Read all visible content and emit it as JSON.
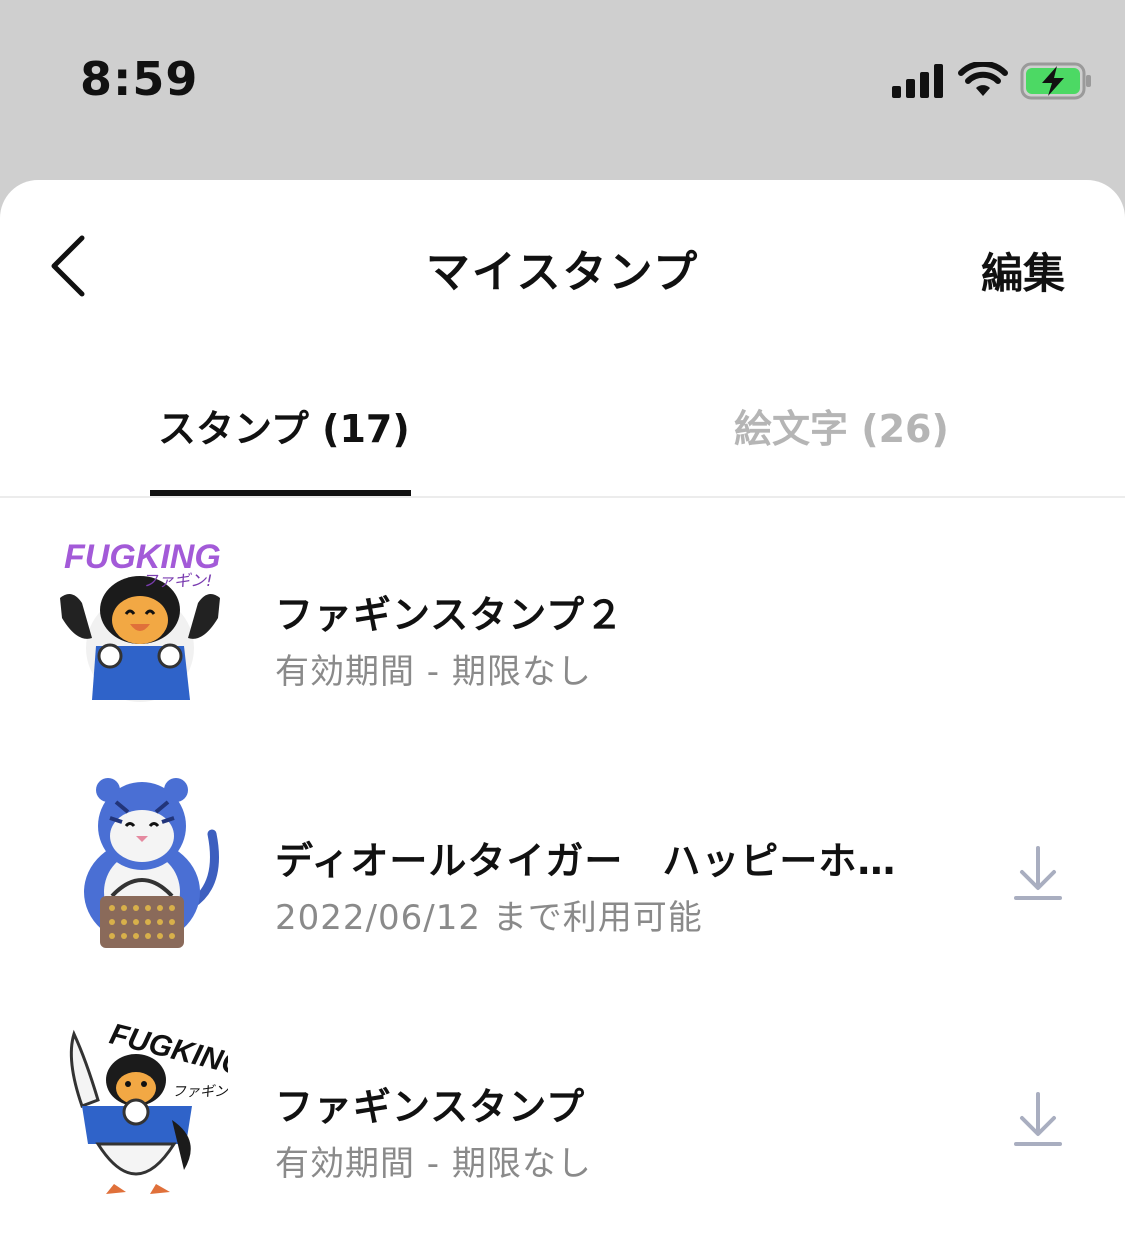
{
  "status_bar": {
    "time": "8:59",
    "icons": [
      "cellular-signal-icon",
      "wifi-icon",
      "battery-charging-icon"
    ],
    "battery_color": "#4cd964"
  },
  "header": {
    "back_icon": "chevron-left-icon",
    "title": "マイスタンプ",
    "edit_label": "編集"
  },
  "tabs": [
    {
      "label": "スタンプ (17)",
      "selected": true
    },
    {
      "label": "絵文字 (26)",
      "selected": false
    }
  ],
  "stickers": [
    {
      "title": "ファギンスタンプ２",
      "subtitle": "有効期間 - 期限なし",
      "thumbnail_text": "FUGKING",
      "thumbnail_subtext": "ファギン!",
      "thumbnail_icon": "penguin-sticker-icon",
      "has_download": false
    },
    {
      "title": "ディオールタイガー　ハッピーホ…",
      "subtitle": "2022/06/12 まで利用可能",
      "thumbnail_icon": "tiger-sticker-icon",
      "has_download": true
    },
    {
      "title": "ファギンスタンプ",
      "subtitle": "有効期間 - 期限なし",
      "thumbnail_text": "FUGKING",
      "thumbnail_subtext": "ファギン!",
      "thumbnail_icon": "penguin-wave-sticker-icon",
      "has_download": true
    }
  ],
  "colors": {
    "sheet_background": "#ffffff",
    "backdrop": "#cfcfcf",
    "primary_text": "#111111",
    "secondary_text": "#8a8a8a",
    "inactive_tab": "#b5b5b5",
    "download_icon": "#a9aec0"
  }
}
